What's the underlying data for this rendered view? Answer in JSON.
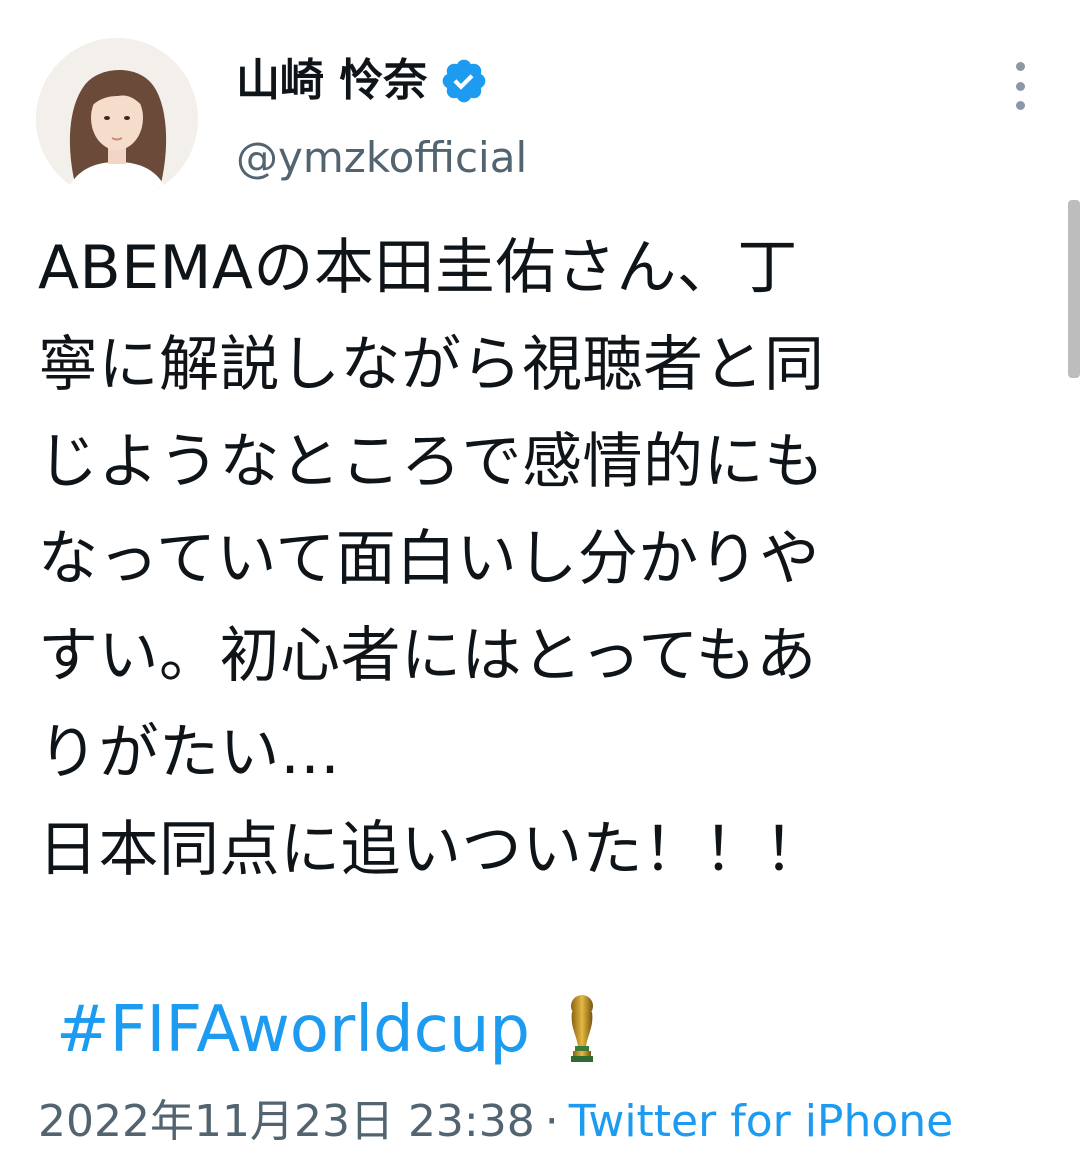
{
  "tweet": {
    "author": {
      "display_name": "山崎 怜奈",
      "handle": "@ymzkofficial",
      "verified": true,
      "avatar_icon": "profile-photo"
    },
    "text": "ABEMAの本田圭佑さん、丁\n寧に解説しながら視聴者と同\nじようなところで感情的にも\nなっていて面白いし分かりや\nすい。初心者にはとってもあ\nりがたい…\n日本同点に追いついた！！！",
    "hashtag": "#FIFAworldcup",
    "hashtag_emoji_icon": "trophy-icon",
    "timestamp": "2022年11月23日 23:38",
    "separator": "·",
    "source": "Twitter for iPhone"
  },
  "colors": {
    "text": "#0f1419",
    "secondary": "#536471",
    "link": "#1d9bf0",
    "verified": "#1d9bf0"
  }
}
